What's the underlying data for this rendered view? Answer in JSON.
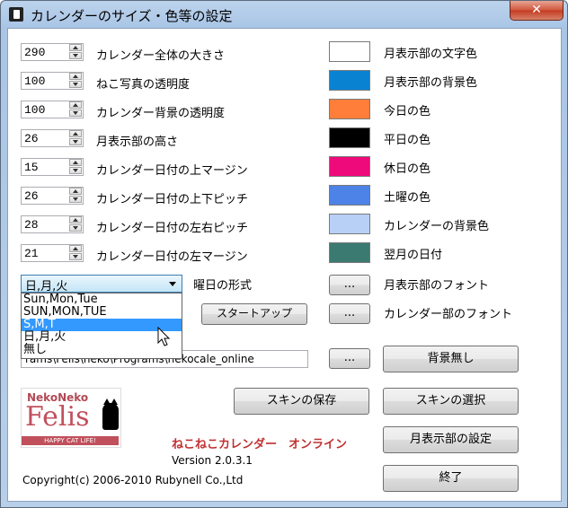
{
  "window": {
    "title": "カレンダーのサイズ・色等の設定",
    "close": "✕"
  },
  "settings": [
    {
      "value": "290",
      "label": "カレンダー全体の大きさ"
    },
    {
      "value": "100",
      "label": "ねこ写真の透明度"
    },
    {
      "value": "100",
      "label": "カレンダー背景の透明度"
    },
    {
      "value": "26",
      "label": "月表示部の高さ"
    },
    {
      "value": "15",
      "label": "カレンダー日付の上マージン"
    },
    {
      "value": "26",
      "label": "カレンダー日付の上下ピッチ"
    },
    {
      "value": "28",
      "label": "カレンダー日付の左右ピッチ"
    },
    {
      "value": "21",
      "label": "カレンダー日付の左マージン"
    }
  ],
  "colors": [
    {
      "color": "#ffffff",
      "label": "月表示部の文字色"
    },
    {
      "color": "#0a82d2",
      "label": "月表示部の背景色"
    },
    {
      "color": "#ff7f3a",
      "label": "今日の色"
    },
    {
      "color": "#000000",
      "label": "平日の色"
    },
    {
      "color": "#ee0a7a",
      "label": "休日の色"
    },
    {
      "color": "#4d82e6",
      "label": "土曜の色"
    },
    {
      "color": "#b9d0f6",
      "label": "カレンダーの背景色"
    },
    {
      "color": "#3b7a70",
      "label": "翌月の日付"
    }
  ],
  "weekday_format": {
    "selected": "日,月,火",
    "label": "曜日の形式",
    "options": [
      "Sun,Mon,Tue",
      "SUN,MON,TUE",
      "S,M,T",
      "日,月,火",
      "無し"
    ],
    "highlighted_index": 2
  },
  "buttons": {
    "month_font_dots": "...",
    "month_font_label": "月表示部のフォント",
    "startup": "スタートアップ",
    "calendar_font_dots": "...",
    "calendar_font_label": "カレンダー部のフォント",
    "background_dots": "...",
    "no_background": "背景無し",
    "save_skin": "スキンの保存",
    "select_skin": "スキンの選択",
    "month_settings": "月表示部の設定",
    "exit": "終了"
  },
  "background_path": "rams\\Felis\\neko\\Programs\\nekocale_online",
  "logo": {
    "top": "NekoNeko",
    "name": "Felis",
    "tagline": "HAPPY CAT LIFE!"
  },
  "about": {
    "app_name": "ねこねこカレンダー　オンライン",
    "version": "Version 2.0.3.1",
    "copyright": "Copyright(c) 2006-2010 Rubynell Co.,Ltd"
  }
}
